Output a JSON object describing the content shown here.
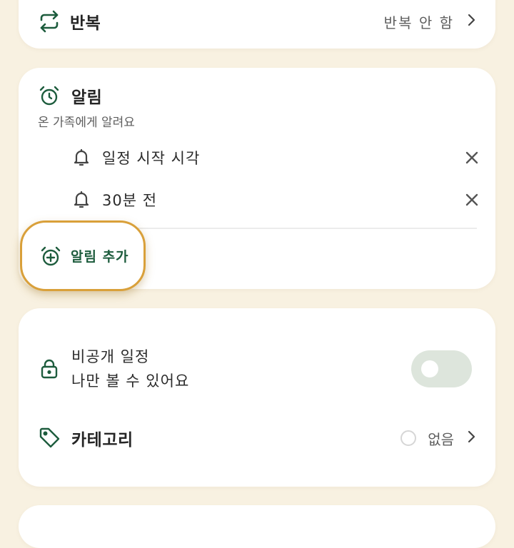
{
  "repeat": {
    "label": "반복",
    "value": "반복 안 함",
    "icon": "repeat-icon"
  },
  "alarm": {
    "title": "알림",
    "subtitle": "온 가족에게 알려요",
    "items": [
      {
        "label": "일정 시작 시각",
        "icon": "bell-icon"
      },
      {
        "label": "30분 전",
        "icon": "bell-icon"
      }
    ],
    "add_label": "알림 추가",
    "highlight_color": "#d9a03a"
  },
  "privacy": {
    "title": "비공개 일정",
    "subtitle": "나만 볼 수 있어요",
    "toggle_on": false
  },
  "category": {
    "label": "카테고리",
    "value": "없음"
  },
  "colors": {
    "accent": "#1d5c3d",
    "background": "#f8f1e1",
    "toggle_track": "#dde5dc"
  }
}
